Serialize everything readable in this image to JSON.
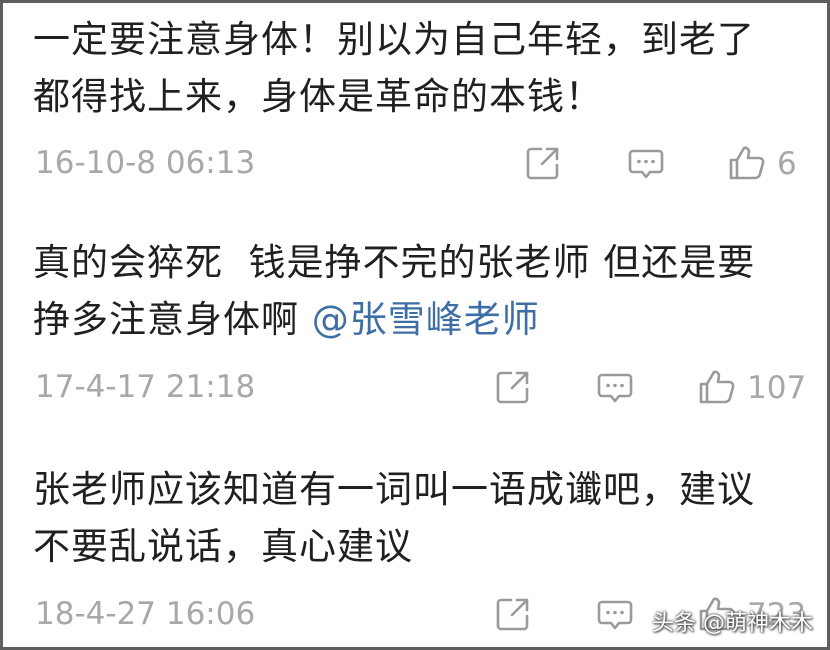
{
  "comments": [
    {
      "text": "一定要注意身体！别以为自己年轻，到老了都得找上来，身体是革命的本钱！",
      "text_line1": "一定要注意身体！别以为自己年轻，到老了",
      "text_line2": "都得找上来，身体是革命的本钱！",
      "timestamp": "16-10-8 06:13",
      "likes": "6"
    },
    {
      "text_line1": "真的会猝死  钱是挣不完的张老师 但还是要",
      "text_line2_prefix": "挣多注意身体啊 ",
      "mention": "@张雪峰老师",
      "timestamp": "17-4-17 21:18",
      "likes": "107"
    },
    {
      "text_line1": "张老师应该知道有一词叫一语成谶吧，建议",
      "text_line2": "不要乱说话，真心建议",
      "timestamp": "18-4-27 16:06",
      "likes": "723"
    }
  ],
  "icons": {
    "share": "share-icon",
    "comment": "comment-icon",
    "like": "thumbs-up-icon"
  },
  "colors": {
    "text": "#202020",
    "meta": "#a8a8a8",
    "mention": "#3d6fa6",
    "border": "#5f5f5f"
  },
  "watermark": "头条 @萌神木木"
}
